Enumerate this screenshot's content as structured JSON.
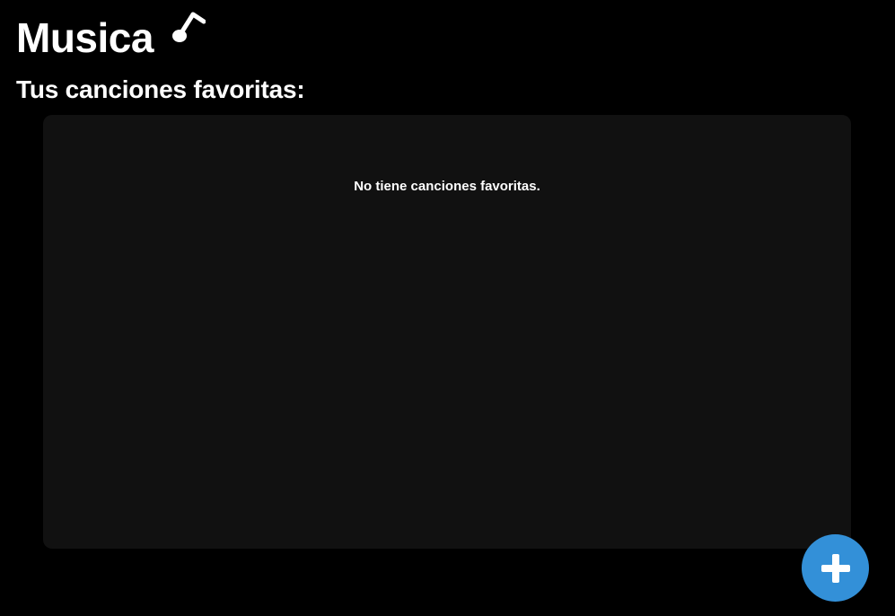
{
  "header": {
    "title": "Musica",
    "icon": "music-note-icon"
  },
  "favorites": {
    "heading": "Tus canciones favoritas:",
    "empty_message": "No tiene canciones favoritas."
  },
  "fab": {
    "icon": "plus-icon"
  },
  "colors": {
    "background": "#000000",
    "panel": "#111111",
    "text": "#ffffff",
    "accent": "#3390d8"
  }
}
